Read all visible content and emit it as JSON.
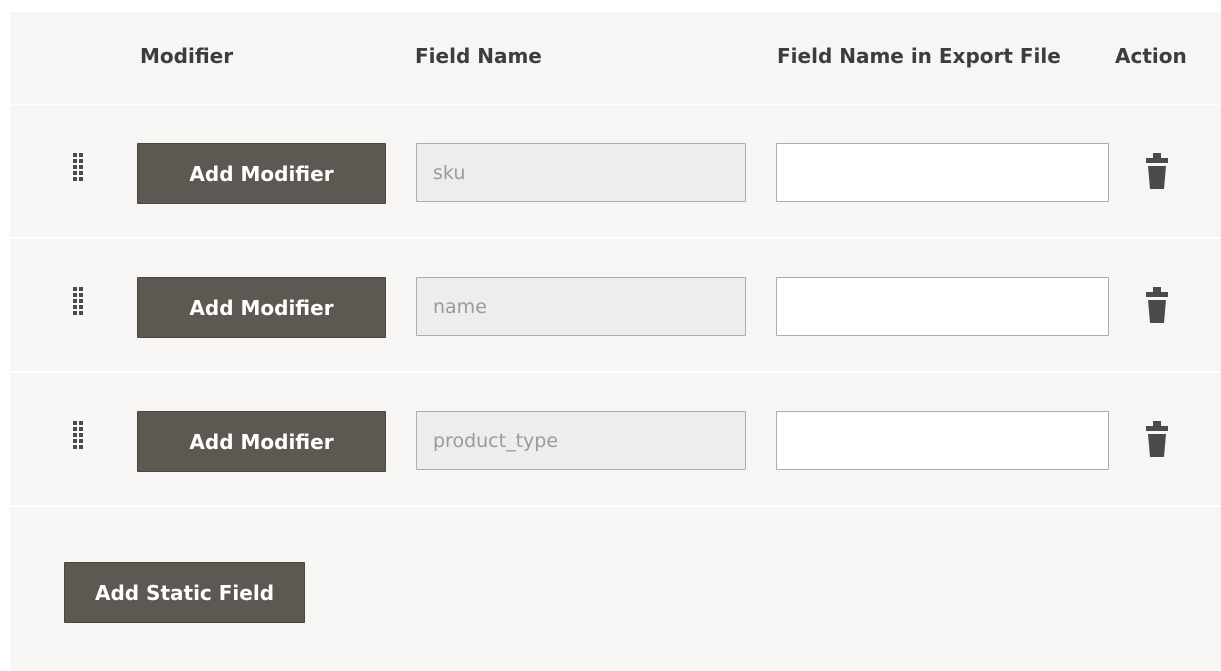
{
  "table": {
    "headers": {
      "modifier": "Modifier",
      "field_name": "Field Name",
      "export_name": "Field Name in Export File",
      "action": "Action"
    },
    "rows": [
      {
        "modifier_button": "Add Modifier",
        "field_name": "sku",
        "export_name": ""
      },
      {
        "modifier_button": "Add Modifier",
        "field_name": "name",
        "export_name": ""
      },
      {
        "modifier_button": "Add Modifier",
        "field_name": "product_type",
        "export_name": ""
      }
    ]
  },
  "add_static_field_label": "Add Static Field",
  "icons": {
    "drag_handle": "drag-handle-icon",
    "delete": "trash-icon"
  },
  "colors": {
    "button_bg": "#5e5852",
    "panel_bg": "#f7f6f5",
    "field_readonly_bg": "#eeedec",
    "icon": "#4a4a4a"
  }
}
